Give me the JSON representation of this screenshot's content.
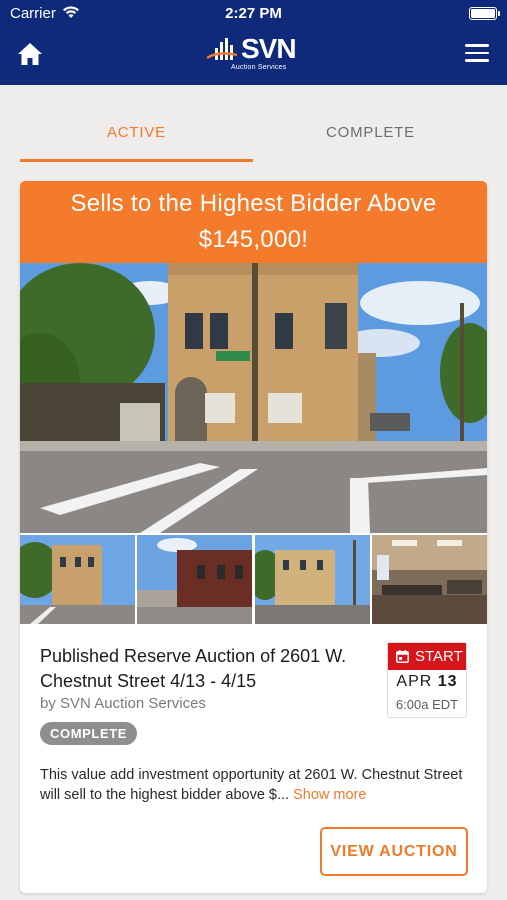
{
  "status_bar": {
    "carrier": "Carrier",
    "time": "2:27 PM"
  },
  "header": {
    "brand": "SVN",
    "brand_sub": "Auction Services",
    "background": "#0f2a7a"
  },
  "tabs": [
    {
      "label": "ACTIVE",
      "selected": true
    },
    {
      "label": "COMPLETE",
      "selected": false
    }
  ],
  "listing": {
    "banner_text": "Sells to the Highest Bidder Above $145,000!",
    "title": "Published Reserve Auction of 2601 W. Chestnut Street 4/13 - 4/15",
    "byline": "by SVN Auction Services",
    "status_badge": "COMPLETE",
    "start": {
      "label": "START",
      "month": "APR",
      "day": "13",
      "time": "6:00a EDT"
    },
    "description": "This value add investment opportunity at 2601 W. Chestnut Street will sell to the highest bidder above $...",
    "show_more": "Show more",
    "cta": "VIEW AUCTION",
    "street_sign": "Chestnut"
  },
  "colors": {
    "accent": "#f07a2a",
    "banner": "#f47b2b",
    "start_red": "#d7141a",
    "badge_gray": "#8e8e8e"
  }
}
